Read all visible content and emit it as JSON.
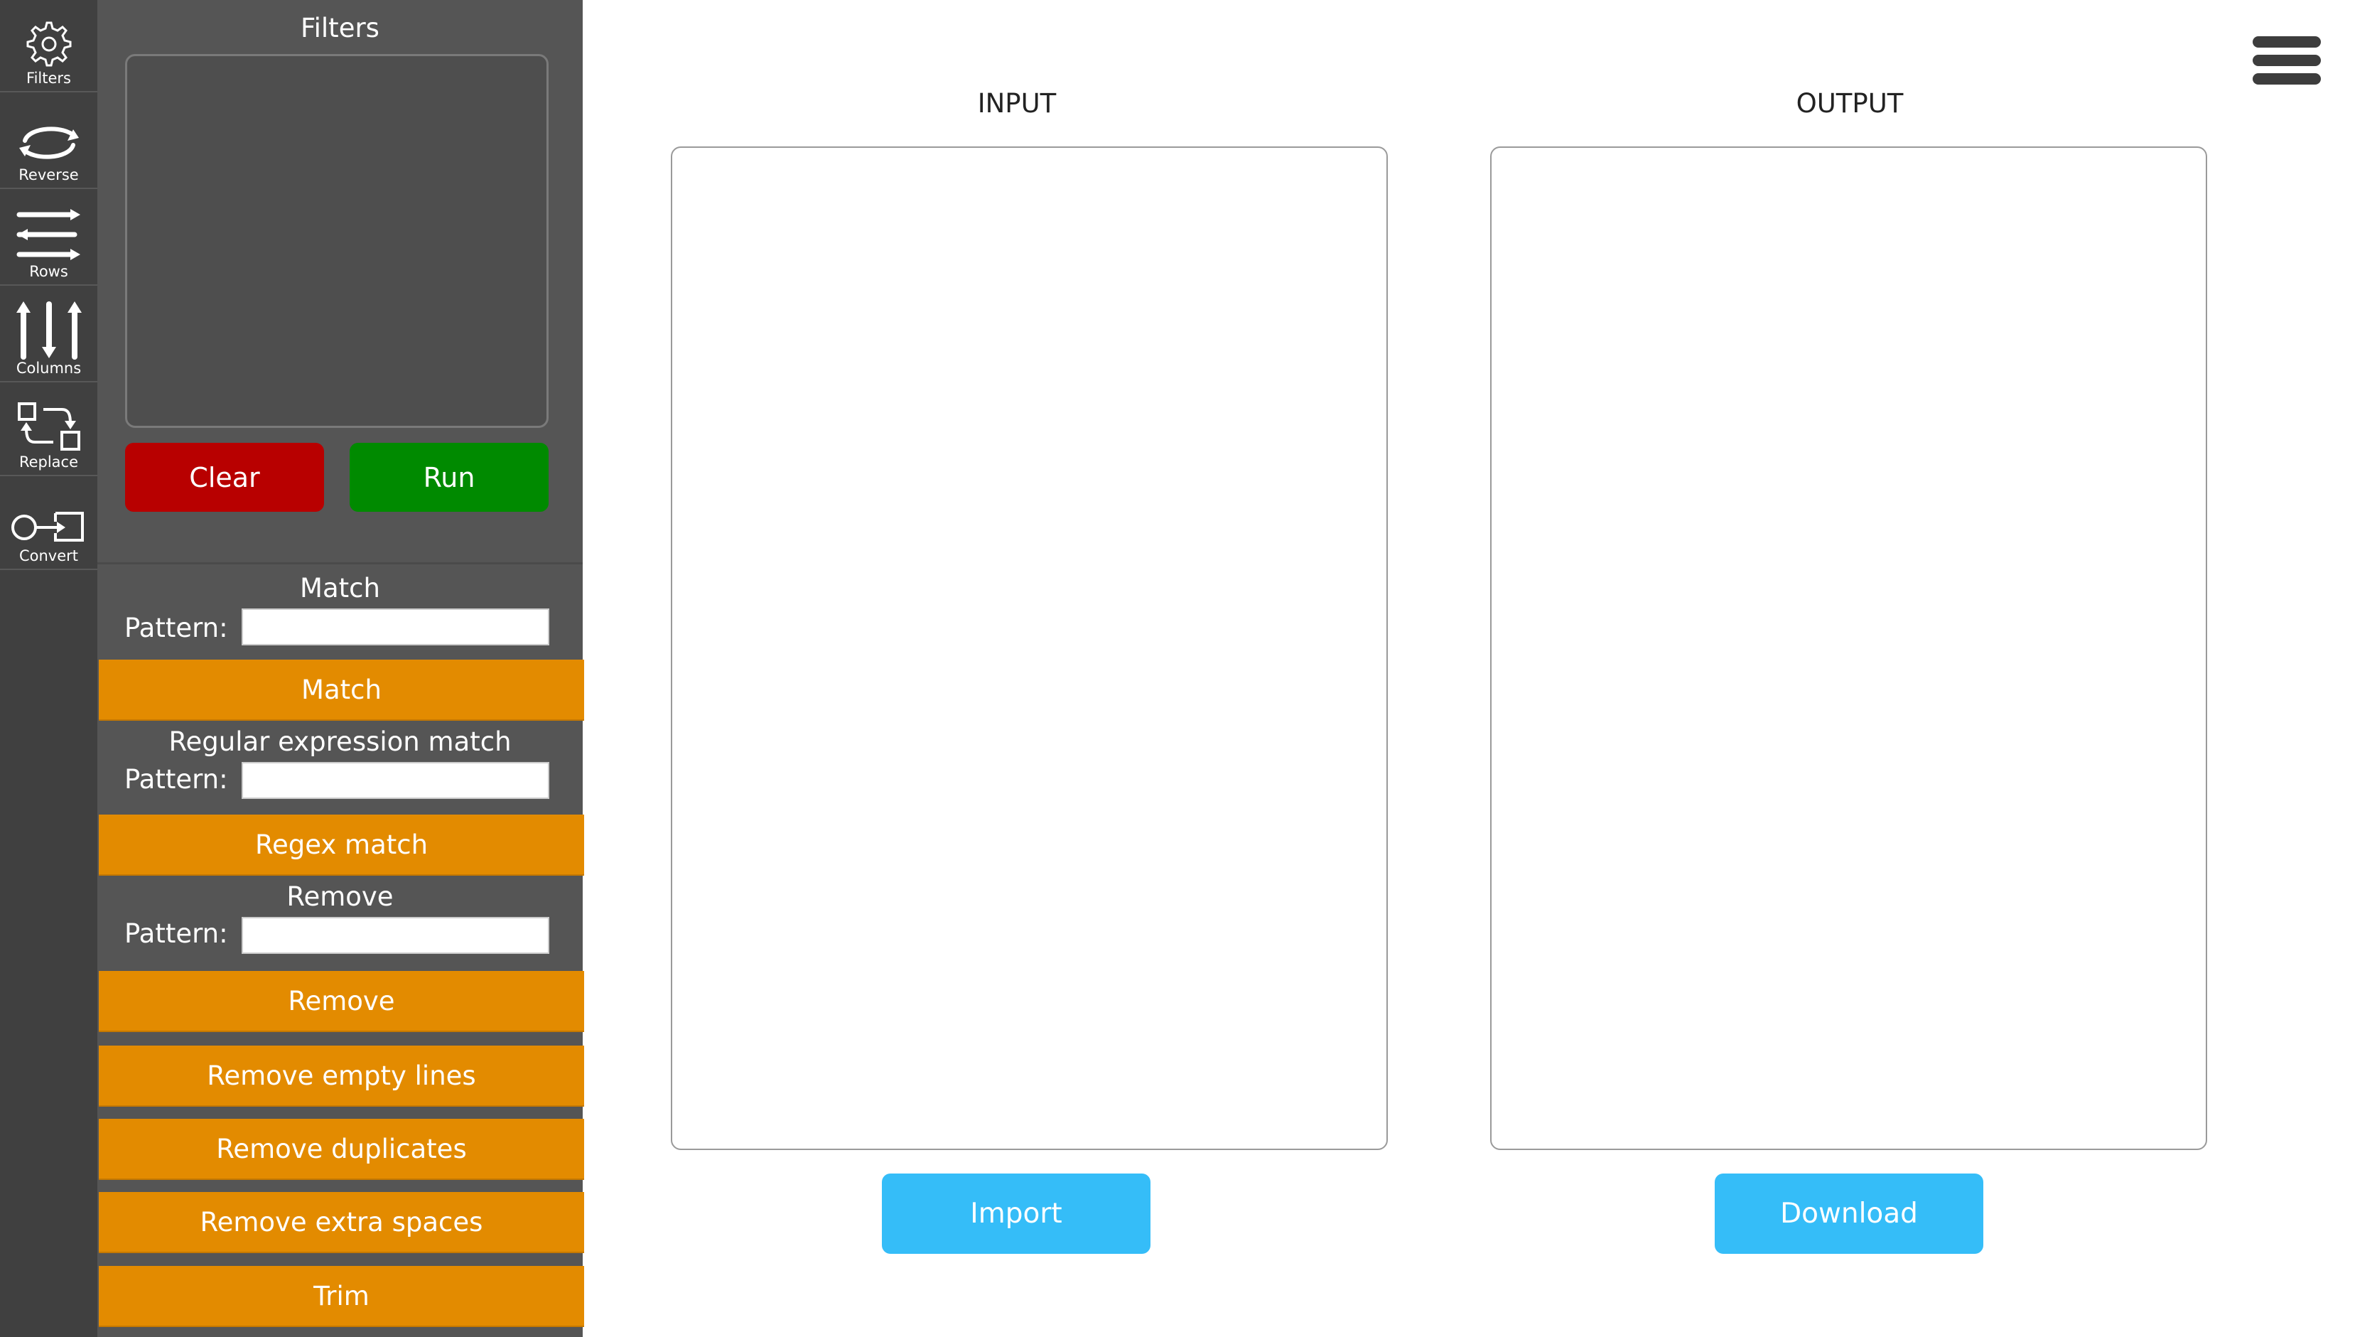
{
  "rail": {
    "items": [
      {
        "label": "Filters",
        "icon": "gear-icon"
      },
      {
        "label": "Reverse",
        "icon": "reverse-icon"
      },
      {
        "label": "Rows",
        "icon": "rows-icon"
      },
      {
        "label": "Columns",
        "icon": "columns-icon"
      },
      {
        "label": "Replace",
        "icon": "replace-icon"
      },
      {
        "label": "Convert",
        "icon": "convert-icon"
      }
    ]
  },
  "sidebar": {
    "title": "Filters",
    "filters_list": "",
    "clear_label": "Clear",
    "run_label": "Run",
    "match": {
      "heading": "Match",
      "pattern_label": "Pattern:",
      "pattern_value": "",
      "button_label": "Match"
    },
    "regex": {
      "heading": "Regular expression match",
      "pattern_label": "Pattern:",
      "pattern_value": "",
      "button_label": "Regex match"
    },
    "remove": {
      "heading": "Remove",
      "pattern_label": "Pattern:",
      "pattern_value": "",
      "button_label": "Remove"
    },
    "remove_empty_lines_label": "Remove empty lines",
    "remove_duplicates_label": "Remove duplicates",
    "remove_extra_spaces_label": "Remove extra spaces",
    "trim_label": "Trim"
  },
  "main": {
    "input_label": "INPUT",
    "output_label": "OUTPUT",
    "input_value": "",
    "output_value": "",
    "import_label": "Import",
    "download_label": "Download"
  },
  "colors": {
    "rail_bg": "#404040",
    "sidebar_bg": "#555555",
    "clear": "#b80000",
    "run": "#008a00",
    "orange": "#e38b00",
    "blue": "#35bdf8"
  }
}
